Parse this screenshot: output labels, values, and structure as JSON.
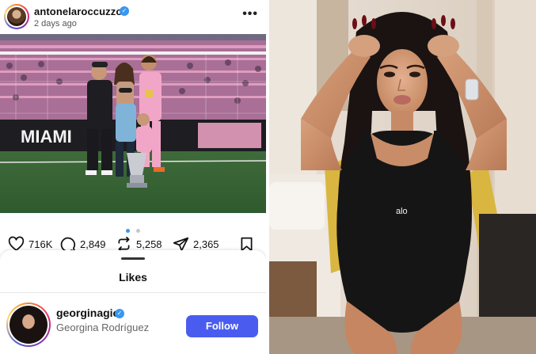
{
  "post": {
    "username": "antonelaroccuzzo",
    "time_ago": "2 days ago",
    "photo_icon": "family-trophy-photo",
    "carousel_pages": 2,
    "carousel_active": 1,
    "stats": {
      "likes": "716K",
      "comments": "2,849",
      "reposts": "5,258",
      "shares": "2,365"
    }
  },
  "likes_sheet": {
    "title": "Likes",
    "user": {
      "username": "georginagio",
      "full_name": "Georgina Rodríguez",
      "follow_label": "Follow"
    }
  },
  "right_photo": {
    "logo_text": "alo"
  },
  "colors": {
    "verified": "#3897f0",
    "follow": "#4a5cf0",
    "team_pink": "#f2a6c7"
  }
}
